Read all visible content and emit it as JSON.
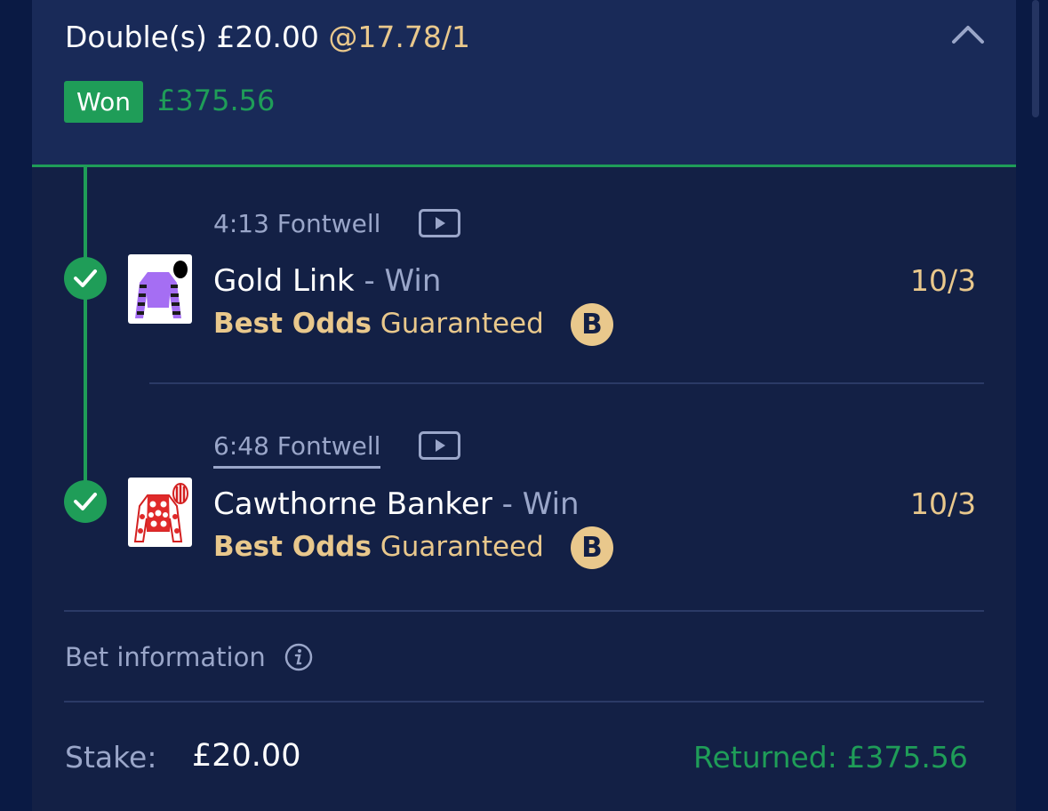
{
  "header": {
    "bet_type": "Double(s)",
    "stake": "£20.00",
    "odds": "@17.78/1",
    "status": "Won",
    "won_amount": "£375.56"
  },
  "legs": [
    {
      "race": "4:13 Fontwell",
      "horse": "Gold Link",
      "market": "- Win",
      "price": "10/3",
      "bog_bold": "Best Odds",
      "bog_rest": "Guaranteed",
      "bog_icon": "B"
    },
    {
      "race": "6:48 Fontwell",
      "horse": "Cawthorne Banker",
      "market": "- Win",
      "price": "10/3",
      "bog_bold": "Best Odds",
      "bog_rest": "Guaranteed",
      "bog_icon": "B"
    }
  ],
  "bet_info": {
    "label": "Bet information"
  },
  "summary": {
    "stake_label": "Stake:",
    "stake_value": "£20.00",
    "returned": "Returned: £375.56"
  },
  "colors": {
    "background": "#0a1a44",
    "card": "#132045",
    "header": "#192a58",
    "success_green": "#1f9d58",
    "gold": "#e9c88c",
    "muted": "#9aa6c9"
  },
  "icons": [
    "chevron-up-icon",
    "check-icon",
    "play-icon",
    "silks-icon",
    "bog-icon",
    "info-icon"
  ]
}
